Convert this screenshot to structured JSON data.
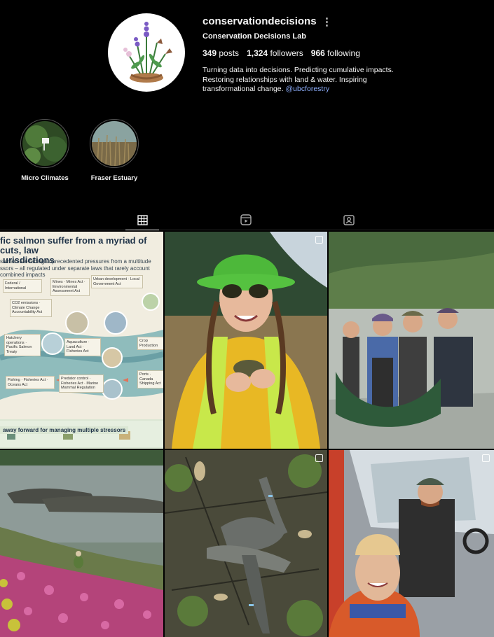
{
  "profile": {
    "username": "conservationdecisions",
    "full_name": "Conservation Decisions Lab",
    "posts_count": "349",
    "posts_label": "posts",
    "followers_count": "1,324",
    "followers_label": "followers",
    "following_count": "966",
    "following_label": "following",
    "bio_lines": [
      "Turning data into decisions. Predicting cumulative impacts.",
      "Restoring relationships with land & water. Inspiring",
      "transformational change."
    ],
    "bio_link": "@ubcforestry"
  },
  "highlights": [
    {
      "label": "Micro Climates"
    },
    {
      "label": "Fraser Estuary"
    }
  ],
  "tabs": [
    {
      "name": "posts",
      "icon": "grid-icon",
      "active": true
    },
    {
      "name": "reels",
      "icon": "reels-icon",
      "active": false
    },
    {
      "name": "tagged",
      "icon": "tagged-icon",
      "active": false
    }
  ],
  "infographic": {
    "title_lines": [
      "fic salmon suffer from a myriad of cuts, law",
      "urisdictions"
    ],
    "subtitle_lines": [
      "salmon are facing unprecedented pressures from a multitude",
      "ssors – all regulated under separate laws that rarely account",
      "combined impacts"
    ],
    "footer": "away forward for managing multiple stressors",
    "boxes": [
      {
        "text": "Federal / International"
      },
      {
        "text": "Mines · Mines Act · Environmental Assessment Act"
      },
      {
        "text": "Urban development · Local Government Act"
      },
      {
        "text": "CO2 emissions · Climate Change Accountability Act"
      },
      {
        "text": "Hatchery operations · Pacific Salmon Treaty"
      },
      {
        "text": "Aquaculture · Land Act · Fisheries Act"
      },
      {
        "text": "Crop Production"
      },
      {
        "text": "Fishing · Fisheries Act · Oceans Act"
      },
      {
        "text": "Predator control · Fisheries Act · Marine Mammal Regulation"
      },
      {
        "text": "Ports · Canada Shipping Act"
      }
    ]
  },
  "colors": {
    "background": "#000000",
    "text": "#f5f5f5",
    "link": "#8fb0ff",
    "divider": "#262626"
  }
}
